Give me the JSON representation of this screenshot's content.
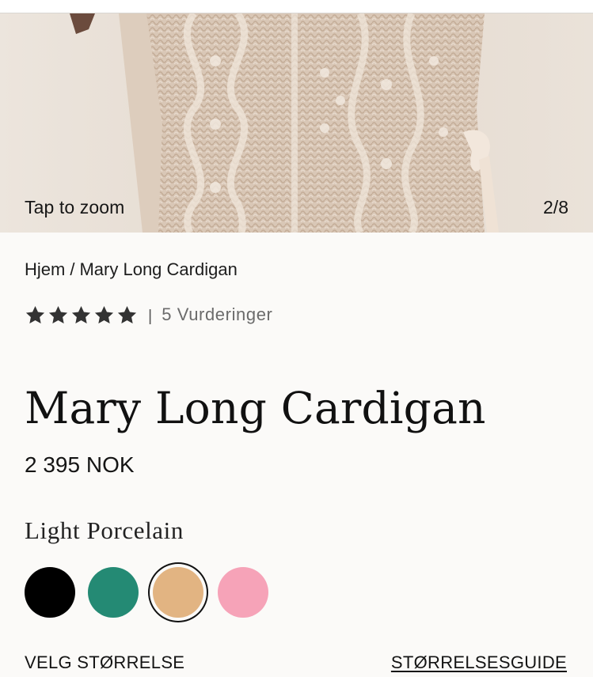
{
  "gallery": {
    "zoom_hint": "Tap to zoom",
    "counter": "2/8"
  },
  "breadcrumb": {
    "home": "Hjem",
    "separator": "/",
    "current": "Mary Long Cardigan"
  },
  "rating": {
    "stars": 5,
    "divider": "|",
    "count_label": "5 Vurderinger",
    "star_icon": "star-icon",
    "star_color": "#333333"
  },
  "product": {
    "title": "Mary Long Cardigan",
    "price": "2 395 NOK"
  },
  "colors": {
    "selected_name": "Light Porcelain",
    "swatches": [
      {
        "name": "black",
        "hex": "#000000",
        "selected": false
      },
      {
        "name": "teal",
        "hex": "#248a74",
        "selected": false
      },
      {
        "name": "light-porcelain",
        "hex": "#e2b482",
        "selected": true
      },
      {
        "name": "pink",
        "hex": "#f6a3b8",
        "selected": false
      }
    ]
  },
  "size": {
    "label": "VELG STØRRELSE",
    "guide_link": "STØRRELSESGUIDE"
  }
}
